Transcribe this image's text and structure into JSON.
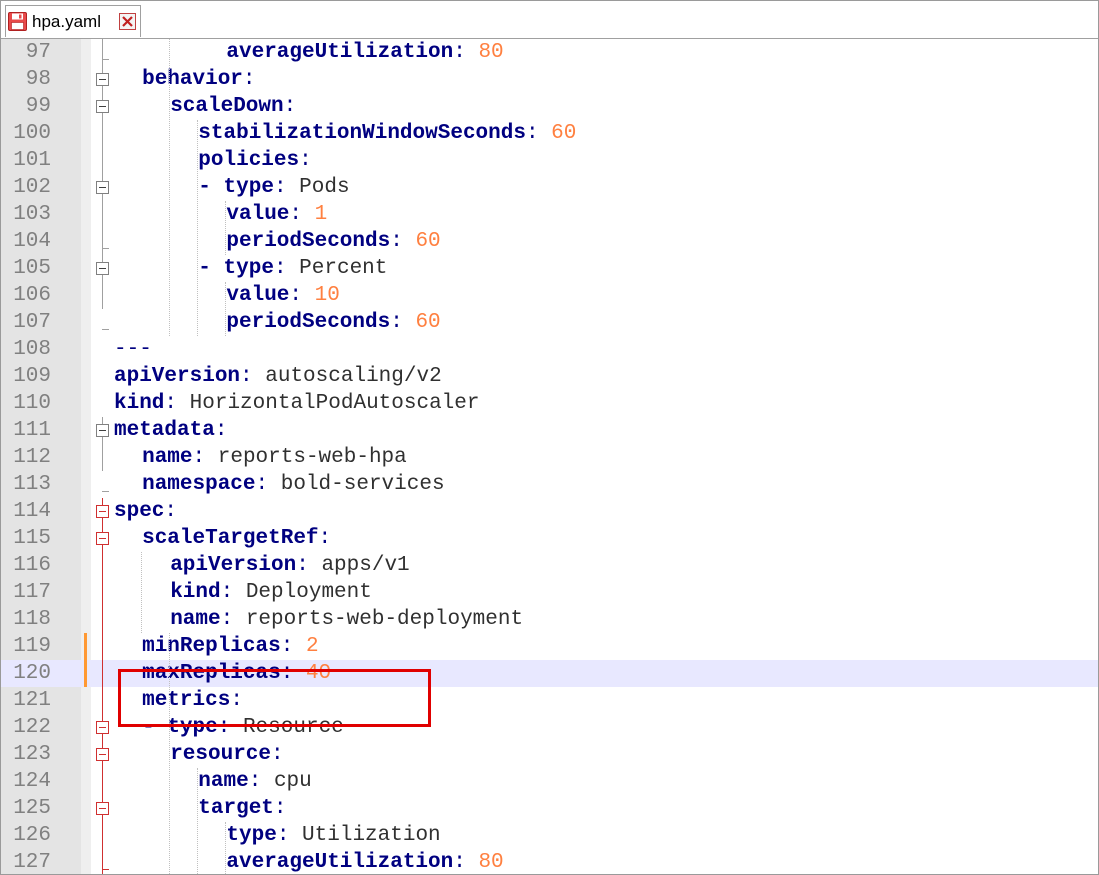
{
  "tab": {
    "label": "hpa.yaml"
  },
  "icons": {
    "file": "floppy-disk-icon",
    "close": "close-icon"
  },
  "colors": {
    "key": "#000080",
    "number": "#ff8040",
    "value": "#303030",
    "line_number": "#808080",
    "highlight_border": "#e00000",
    "current_line": "#e8e8ff",
    "change_marker": "#ff9933"
  },
  "lines": [
    {
      "n": "97",
      "indent": 8,
      "key": "averageUtilization",
      "val": "80",
      "type": "num"
    },
    {
      "n": "98",
      "indent": 2,
      "key": "behavior",
      "val": "",
      "type": "none"
    },
    {
      "n": "99",
      "indent": 4,
      "key": "scaleDown",
      "val": "",
      "type": "none"
    },
    {
      "n": "100",
      "indent": 6,
      "key": "stabilizationWindowSeconds",
      "val": "60",
      "type": "num"
    },
    {
      "n": "101",
      "indent": 6,
      "key": "policies",
      "val": "",
      "type": "none"
    },
    {
      "n": "102",
      "indent": 6,
      "dash": true,
      "key": "type",
      "val": "Pods",
      "type": "str"
    },
    {
      "n": "103",
      "indent": 8,
      "key": "value",
      "val": "1",
      "type": "num"
    },
    {
      "n": "104",
      "indent": 8,
      "key": "periodSeconds",
      "val": "60",
      "type": "num"
    },
    {
      "n": "105",
      "indent": 6,
      "dash": true,
      "key": "type",
      "val": "Percent",
      "type": "str"
    },
    {
      "n": "106",
      "indent": 8,
      "key": "value",
      "val": "10",
      "type": "num"
    },
    {
      "n": "107",
      "indent": 8,
      "key": "periodSeconds",
      "val": "60",
      "type": "num"
    },
    {
      "n": "108",
      "indent": 0,
      "raw": "---"
    },
    {
      "n": "109",
      "indent": 0,
      "key": "apiVersion",
      "val": "autoscaling/v2",
      "type": "str"
    },
    {
      "n": "110",
      "indent": 0,
      "key": "kind",
      "val": "HorizontalPodAutoscaler",
      "type": "str"
    },
    {
      "n": "111",
      "indent": 0,
      "key": "metadata",
      "val": "",
      "type": "none"
    },
    {
      "n": "112",
      "indent": 2,
      "key": "name",
      "val": "reports-web-hpa",
      "type": "str"
    },
    {
      "n": "113",
      "indent": 2,
      "key": "namespace",
      "val": "bold-services",
      "type": "str"
    },
    {
      "n": "114",
      "indent": 0,
      "key": "spec",
      "val": "",
      "type": "none"
    },
    {
      "n": "115",
      "indent": 2,
      "key": "scaleTargetRef",
      "val": "",
      "type": "none"
    },
    {
      "n": "116",
      "indent": 4,
      "key": "apiVersion",
      "val": "apps/v1",
      "type": "str"
    },
    {
      "n": "117",
      "indent": 4,
      "key": "kind",
      "val": "Deployment",
      "type": "str"
    },
    {
      "n": "118",
      "indent": 4,
      "key": "name",
      "val": "reports-web-deployment",
      "type": "str"
    },
    {
      "n": "119",
      "indent": 2,
      "key": "minReplicas",
      "val": "2",
      "type": "num"
    },
    {
      "n": "120",
      "indent": 2,
      "key": "maxReplicas",
      "val": "40",
      "type": "num"
    },
    {
      "n": "121",
      "indent": 2,
      "key": "metrics",
      "val": "",
      "type": "none"
    },
    {
      "n": "122",
      "indent": 2,
      "dash": true,
      "key": "type",
      "val": "Resource",
      "type": "str"
    },
    {
      "n": "123",
      "indent": 4,
      "key": "resource",
      "val": "",
      "type": "none"
    },
    {
      "n": "124",
      "indent": 6,
      "key": "name",
      "val": "cpu",
      "type": "str"
    },
    {
      "n": "125",
      "indent": 6,
      "key": "target",
      "val": "",
      "type": "none"
    },
    {
      "n": "126",
      "indent": 8,
      "key": "type",
      "val": "Utilization",
      "type": "str"
    },
    {
      "n": "127",
      "indent": 8,
      "key": "averageUtilization",
      "val": "80",
      "type": "num"
    }
  ],
  "current_line": "120",
  "highlighted_lines": [
    "119",
    "120"
  ]
}
